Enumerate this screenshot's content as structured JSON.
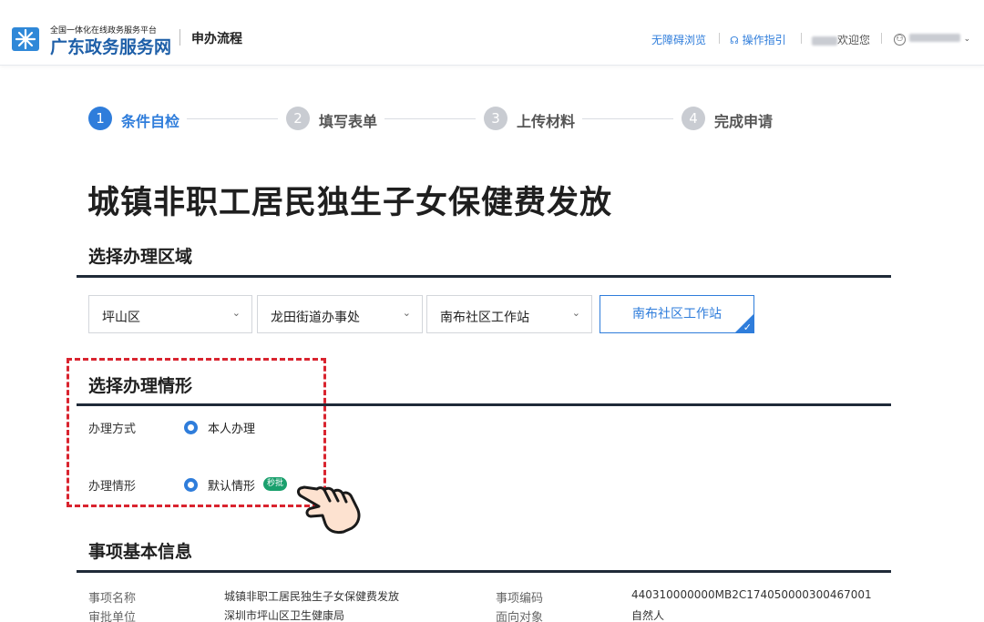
{
  "header": {
    "logo_small": "全国一体化在线政务服务平台",
    "logo_big": "广东政务服务网",
    "page_title": "申办流程",
    "accessibility": "无障碍浏览",
    "guide": "操作指引",
    "welcome": "欢迎您"
  },
  "steps": [
    {
      "num": "1",
      "label": "条件自检",
      "active": true
    },
    {
      "num": "2",
      "label": "填写表单",
      "active": false
    },
    {
      "num": "3",
      "label": "上传材料",
      "active": false
    },
    {
      "num": "4",
      "label": "完成申请",
      "active": false
    }
  ],
  "main_title": "城镇非职工居民独生子女保健费发放",
  "region": {
    "title": "选择办理区域",
    "selects": [
      "坪山区",
      "龙田街道办事处",
      "南布社区工作站"
    ],
    "selected_card": "南布社区工作站"
  },
  "situation": {
    "title": "选择办理情形",
    "method_label": "办理方式",
    "method_value": "本人办理",
    "case_label": "办理情形",
    "case_value": "默认情形",
    "badge": "秒批"
  },
  "info": {
    "title": "事项基本信息",
    "rows": [
      {
        "label1": "事项名称",
        "value1": "城镇非职工居民独生子女保健费发放",
        "label2": "事项编码",
        "value2": "440310000000MB2C174050000300467001"
      },
      {
        "label1": "审批单位",
        "value1": "深圳市坪山区卫生健康局",
        "label2": "面向对象",
        "value2": "自然人"
      }
    ]
  },
  "colors": {
    "accent": "#2f7ddb",
    "dashed_border": "#d9242f",
    "badge": "#1aa06d",
    "step_inactive": "#c9ccd2"
  }
}
